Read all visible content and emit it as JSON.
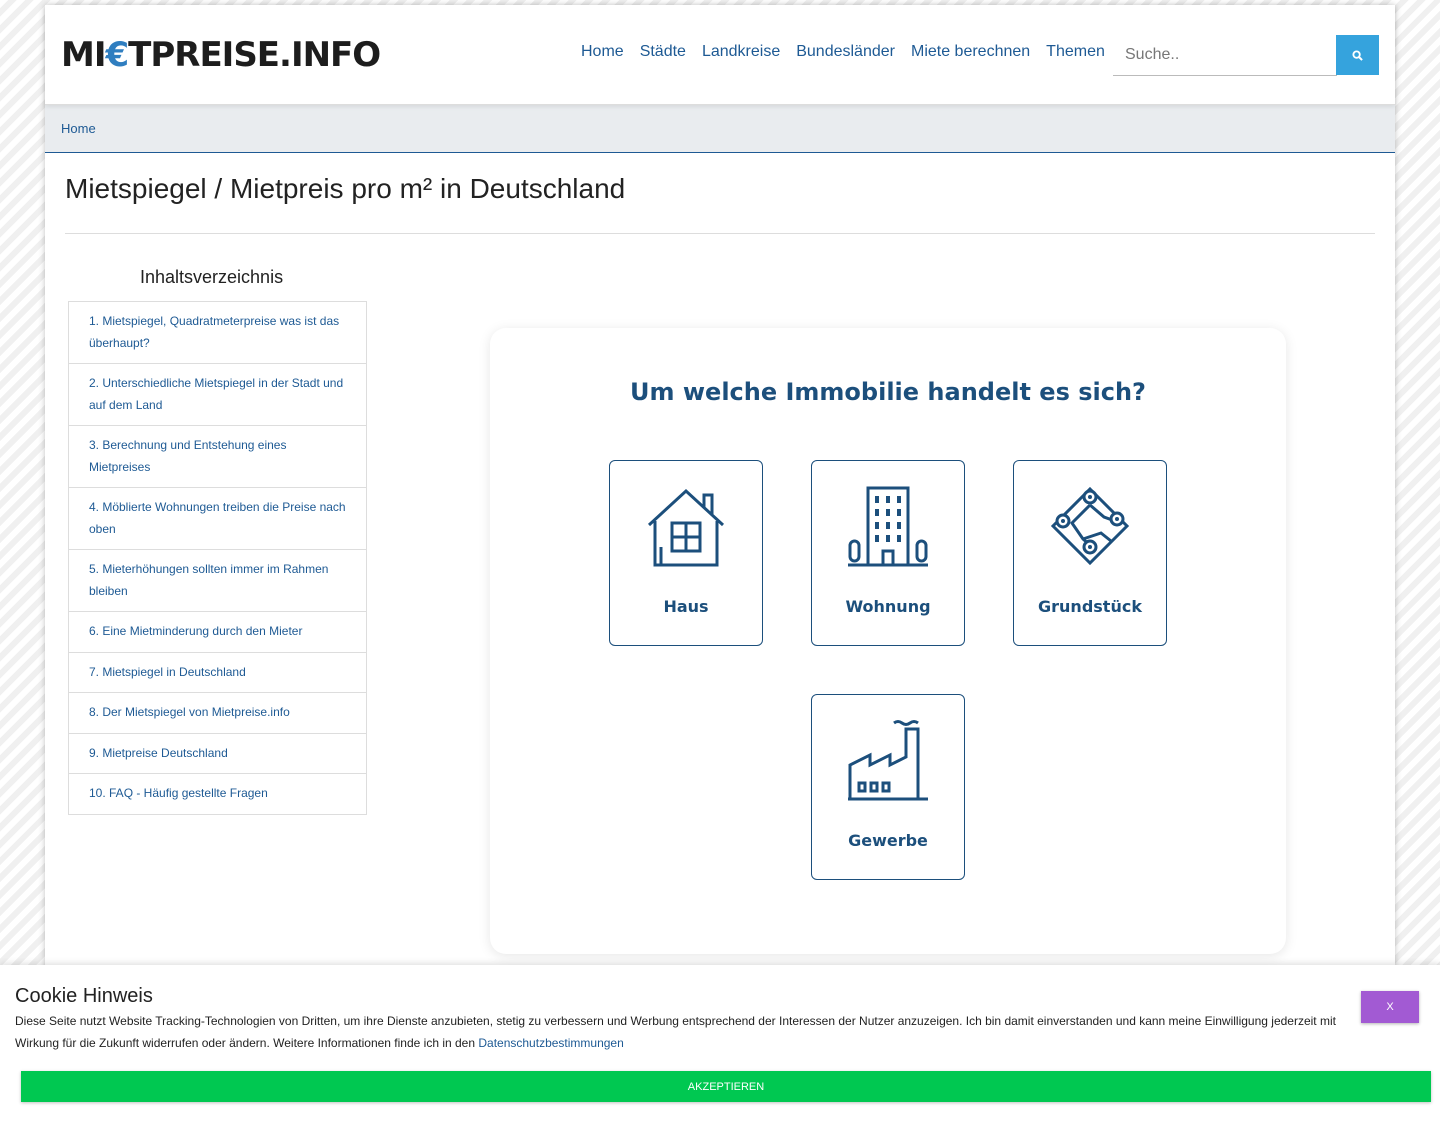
{
  "header": {
    "logo_part1": "MI",
    "logo_euro": "€",
    "logo_part2": "TPREISE.INFO",
    "nav": [
      "Home",
      "Städte",
      "Landkreise",
      "Bundesländer",
      "Miete berechnen",
      "Themen"
    ],
    "search_placeholder": "Suche.."
  },
  "breadcrumb": {
    "home": "Home"
  },
  "page_title": "Mietspiegel / Mietpreis pro m² in Deutschland",
  "toc": {
    "heading": " Inhaltsverzeichnis",
    "items": [
      "1. Mietspiegel, Quadratmeterpreise was ist das überhaupt?",
      "2. Unterschiedliche Mietspiegel in der Stadt und auf dem Land",
      "3. Berechnung und Entstehung eines Mietpreises",
      "4. Möblierte Wohnungen treiben die Preise nach oben",
      "5. Mieterhöhungen sollten immer im Rahmen bleiben",
      "6. Eine Mietminderung durch den Mieter",
      "7. Mietspiegel in Deutschland",
      "8. Der Mietspiegel von Mietpreise.info",
      "9. Mietpreise Deutschland",
      "10. FAQ - Häufig gestellte Fragen"
    ]
  },
  "selector": {
    "heading": "Um welche Immobilie handelt es sich?",
    "options": [
      {
        "label": "Haus",
        "icon": "house-icon"
      },
      {
        "label": "Wohnung",
        "icon": "building-icon"
      },
      {
        "label": "Grundstück",
        "icon": "plot-icon"
      },
      {
        "label": "Gewerbe",
        "icon": "factory-icon"
      }
    ]
  },
  "cookie": {
    "title": "Cookie Hinweis",
    "text": "Diese Seite nutzt Website Tracking-Technologien von Dritten, um ihre Dienste anzubieten, stetig zu verbessern und Werbung entsprechend der Interessen der Nutzer anzuzeigen. Ich bin damit einverstanden und kann meine Einwilligung jederzeit mit Wirkung für die Zukunft widerrufen oder ändern. Weitere Informationen finde ich in den ",
    "link": "Datenschutzbestimmungen",
    "close_label": "X",
    "accept_label": "AKZEPTIEREN"
  },
  "colors": {
    "brand": "#1c4f7c",
    "link": "#1e5a94",
    "search_button": "#35a3dd",
    "accept": "#00c851",
    "close": "#a25ad3"
  }
}
